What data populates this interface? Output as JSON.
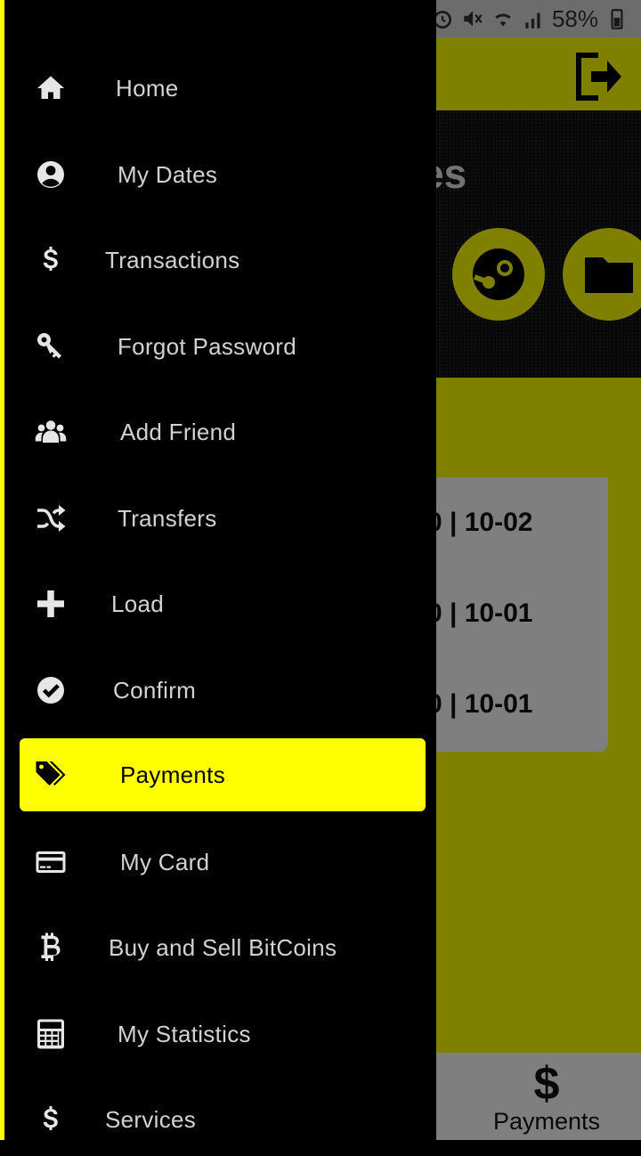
{
  "status_bar": {
    "battery": "58%"
  },
  "background": {
    "hero_title": "services",
    "card_title": "es",
    "rows": [
      "0 | 10-02",
      "0 | 10-01",
      "0 | 10-01"
    ]
  },
  "bottom_nav": {
    "icon": "$",
    "label": "Payments"
  },
  "drawer": {
    "items": [
      {
        "label": "Home",
        "icon": "home-icon",
        "active": false
      },
      {
        "label": "My Dates",
        "icon": "user-circle-icon",
        "active": false
      },
      {
        "label": "Transactions",
        "icon": "dollar-icon",
        "active": false
      },
      {
        "label": "Forgot Password",
        "icon": "key-icon",
        "active": false
      },
      {
        "label": "Add Friend",
        "icon": "users-icon",
        "active": false
      },
      {
        "label": "Transfers",
        "icon": "shuffle-icon",
        "active": false
      },
      {
        "label": "Load",
        "icon": "plus-icon",
        "active": false
      },
      {
        "label": "Confirm",
        "icon": "check-circle-icon",
        "active": false
      },
      {
        "label": "Payments",
        "icon": "tags-icon",
        "active": true
      },
      {
        "label": "My Card",
        "icon": "credit-card-icon",
        "active": false
      },
      {
        "label": "Buy and Sell BitCoins",
        "icon": "bitcoin-icon",
        "active": false
      },
      {
        "label": "My Statistics",
        "icon": "calculator-icon",
        "active": false
      },
      {
        "label": "Services",
        "icon": "dollar-icon",
        "active": false
      }
    ]
  },
  "colors": {
    "accent": "#ffff00",
    "drawer_bg": "#000000"
  }
}
